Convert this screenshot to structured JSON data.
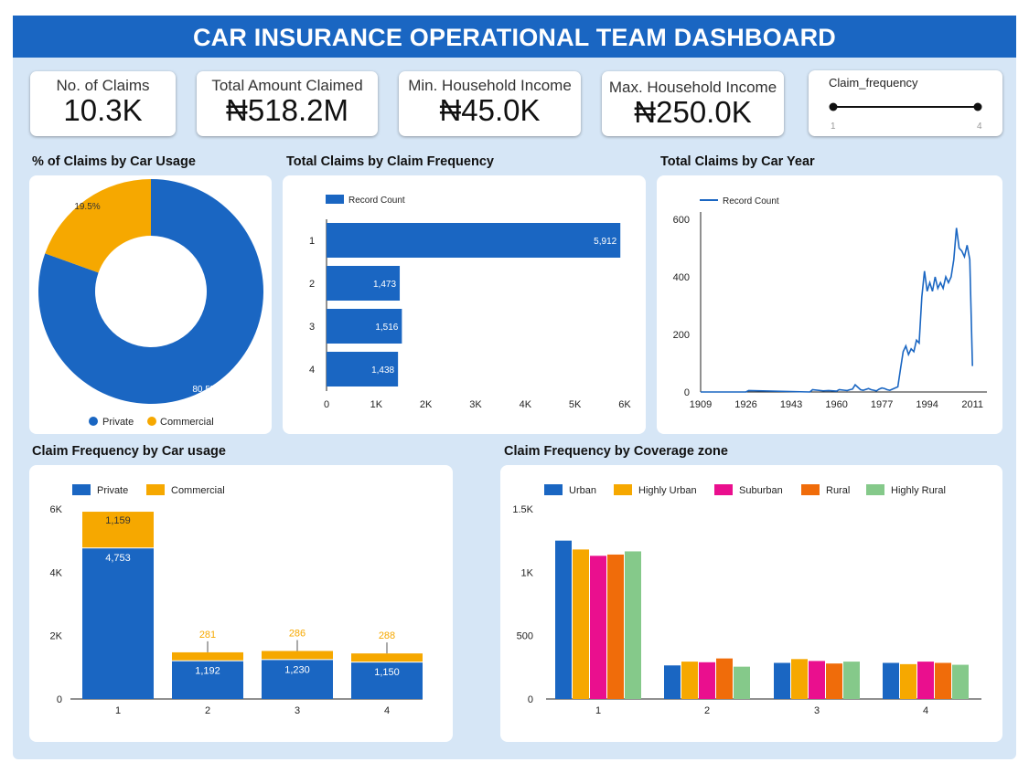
{
  "header": {
    "title": "CAR INSURANCE OPERATIONAL TEAM DASHBOARD"
  },
  "kpis": [
    {
      "label": "No. of Claims",
      "value": "10.3K"
    },
    {
      "label": "Total Amount Claimed",
      "value": "₦518.2M"
    },
    {
      "label": "Min. Household Income",
      "value": "₦45.0K"
    },
    {
      "label": "Max. Household Income",
      "value": "₦250.0K"
    }
  ],
  "slider": {
    "title": "Claim_frequency",
    "min_label": "1",
    "max_label": "4",
    "min": 1,
    "max": 4
  },
  "colors": {
    "blue": "#1a66c2",
    "orange": "#f6a800",
    "highly_urban": "#f6a800",
    "suburban": "#ea0f8e",
    "rural": "#f06c0a",
    "highly_rural": "#85c98a"
  },
  "charts": {
    "usage_donut": {
      "title": "% of Claims by Car Usage",
      "chart_data": {
        "type": "pie",
        "labels": [
          "Private",
          "Commercial"
        ],
        "values": [
          80.5,
          19.5
        ],
        "value_labels": [
          "80.5%",
          "19.5%"
        ],
        "donut": true,
        "legend": "bottom"
      }
    },
    "freq_bar": {
      "title": "Total Claims by Claim Frequency",
      "chart_data": {
        "type": "bar",
        "orientation": "horizontal",
        "series": [
          {
            "name": "Record Count",
            "values": [
              5912,
              1473,
              1516,
              1438
            ]
          }
        ],
        "categories": [
          "1",
          "2",
          "3",
          "4"
        ],
        "value_labels": [
          "5,912",
          "1,473",
          "1,516",
          "1,438"
        ],
        "xlim": [
          0,
          6000
        ],
        "ticks": [
          "0",
          "1K",
          "2K",
          "3K",
          "4K",
          "5K",
          "6K"
        ],
        "legend": "top-left"
      }
    },
    "year_line": {
      "title": "Total Claims by Car Year",
      "chart_data": {
        "type": "line",
        "series": [
          {
            "name": "Record Count"
          }
        ],
        "x": [
          1909,
          1926,
          1927,
          1950,
          1951,
          1955,
          1957,
          1960,
          1961,
          1963,
          1964,
          1965,
          1966,
          1967,
          1969,
          1970,
          1972,
          1973,
          1975,
          1976,
          1977,
          1978,
          1979,
          1980,
          1981,
          1982,
          1983,
          1984,
          1985,
          1986,
          1987,
          1988,
          1989,
          1990,
          1991,
          1992,
          1993,
          1994,
          1995,
          1996,
          1997,
          1998,
          1999,
          2000,
          2001,
          2002,
          2003,
          2004,
          2005,
          2006,
          2007,
          2008,
          2009,
          2010,
          2011,
          2012,
          2013
        ],
        "y": [
          0,
          0,
          5,
          0,
          8,
          4,
          5,
          3,
          8,
          6,
          5,
          8,
          10,
          25,
          8,
          6,
          12,
          8,
          4,
          10,
          14,
          12,
          8,
          6,
          10,
          14,
          18,
          80,
          140,
          160,
          130,
          150,
          140,
          180,
          170,
          330,
          420,
          350,
          380,
          350,
          400,
          360,
          380,
          360,
          400,
          380,
          400,
          460,
          570,
          500,
          490,
          470,
          510,
          460,
          90
        ],
        "xticks": [
          "1909",
          "1926",
          "1943",
          "1960",
          "1977",
          "1994",
          "2011"
        ],
        "yticks": [
          "0",
          "200",
          "400",
          "600"
        ],
        "ylim": [
          0,
          600
        ],
        "legend": "top-left"
      }
    },
    "usage_stacked": {
      "title": "Claim Frequency by Car usage",
      "chart_data": {
        "type": "bar",
        "stacked": true,
        "categories": [
          "1",
          "2",
          "3",
          "4"
        ],
        "series": [
          {
            "name": "Private",
            "values": [
              4753,
              1192,
              1230,
              1150
            ],
            "value_labels": [
              "4,753",
              "1,192",
              "1,230",
              "1,150"
            ]
          },
          {
            "name": "Commercial",
            "values": [
              1159,
              281,
              286,
              288
            ],
            "value_labels": [
              "1,159",
              "281",
              "286",
              "288"
            ]
          }
        ],
        "ylim": [
          0,
          6000
        ],
        "yticks": [
          "0",
          "2K",
          "4K",
          "6K"
        ],
        "legend": "top-left"
      }
    },
    "zone_grouped": {
      "title": "Claim Frequency by Coverage zone",
      "chart_data": {
        "type": "bar",
        "grouped": true,
        "categories": [
          "1",
          "2",
          "3",
          "4"
        ],
        "series": [
          {
            "name": "Urban",
            "values": [
              1250,
              265,
              285,
              285
            ]
          },
          {
            "name": "Highly Urban",
            "values": [
              1180,
              295,
              315,
              275
            ]
          },
          {
            "name": "Suburban",
            "values": [
              1130,
              290,
              300,
              295
            ]
          },
          {
            "name": "Rural",
            "values": [
              1140,
              320,
              280,
              285
            ]
          },
          {
            "name": "Highly Rural",
            "values": [
              1165,
              255,
              295,
              270
            ]
          }
        ],
        "ylim": [
          0,
          1500
        ],
        "yticks": [
          "0",
          "500",
          "1K",
          "1.5K"
        ],
        "legend": "top-left"
      }
    }
  }
}
